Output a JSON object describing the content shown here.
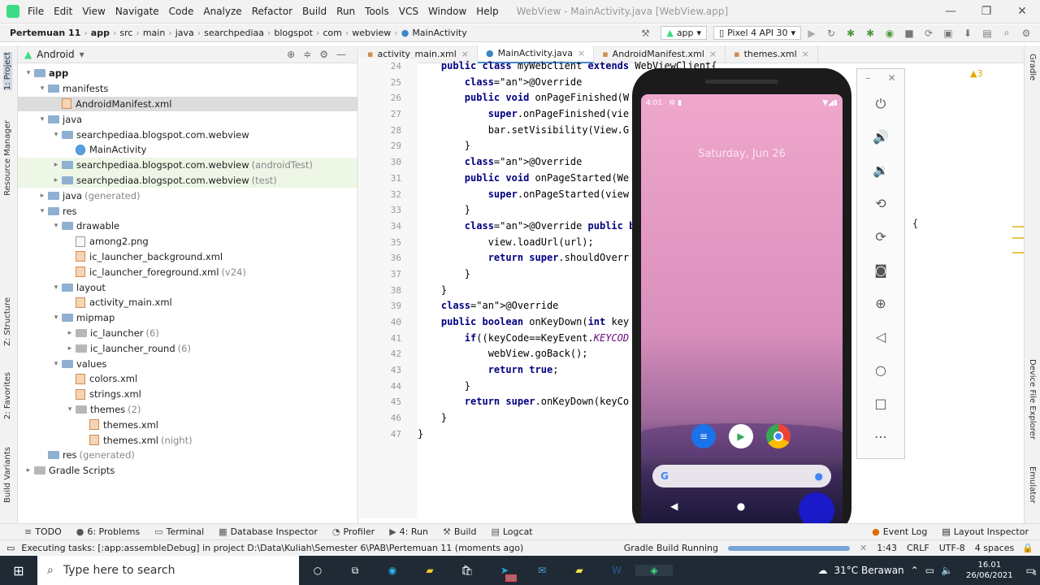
{
  "menu": {
    "items": [
      "File",
      "Edit",
      "View",
      "Navigate",
      "Code",
      "Analyze",
      "Refactor",
      "Build",
      "Run",
      "Tools",
      "VCS",
      "Window",
      "Help"
    ],
    "title": "WebView - MainActivity.java [WebView.app]"
  },
  "nav": {
    "breadcrumbs": [
      "Pertemuan 11",
      "app",
      "src",
      "main",
      "java",
      "searchpediaa",
      "blogspot",
      "com",
      "webview",
      "MainActivity"
    ],
    "run_config": "app",
    "device": "Pixel 4 API 30"
  },
  "project": {
    "view": "Android",
    "tree": [
      {
        "label": "app",
        "depth": 0,
        "arrow": "▾",
        "icon": "folder",
        "bold": true
      },
      {
        "label": "manifests",
        "depth": 1,
        "arrow": "▾",
        "icon": "folder"
      },
      {
        "label": "AndroidManifest.xml",
        "depth": 2,
        "arrow": "",
        "icon": "xml",
        "sel": true
      },
      {
        "label": "java",
        "depth": 1,
        "arrow": "▾",
        "icon": "folder"
      },
      {
        "label": "searchpediaa.blogspot.com.webview",
        "depth": 2,
        "arrow": "▾",
        "icon": "folder"
      },
      {
        "label": "MainActivity",
        "depth": 3,
        "arrow": "",
        "icon": "cls"
      },
      {
        "label": "searchpediaa.blogspot.com.webview",
        "extra": "(androidTest)",
        "depth": 2,
        "arrow": "▸",
        "icon": "folder",
        "hl": true
      },
      {
        "label": "searchpediaa.blogspot.com.webview",
        "extra": "(test)",
        "depth": 2,
        "arrow": "▸",
        "icon": "folder",
        "hl": true
      },
      {
        "label": "java",
        "extra": "(generated)",
        "depth": 1,
        "arrow": "▸",
        "icon": "folder"
      },
      {
        "label": "res",
        "depth": 1,
        "arrow": "▾",
        "icon": "folder"
      },
      {
        "label": "drawable",
        "depth": 2,
        "arrow": "▾",
        "icon": "folder"
      },
      {
        "label": "among2.png",
        "depth": 3,
        "arrow": "",
        "icon": "file"
      },
      {
        "label": "ic_launcher_background.xml",
        "depth": 3,
        "arrow": "",
        "icon": "xml"
      },
      {
        "label": "ic_launcher_foreground.xml",
        "extra": "(v24)",
        "depth": 3,
        "arrow": "",
        "icon": "xml"
      },
      {
        "label": "layout",
        "depth": 2,
        "arrow": "▾",
        "icon": "folder"
      },
      {
        "label": "activity_main.xml",
        "depth": 3,
        "arrow": "",
        "icon": "xml"
      },
      {
        "label": "mipmap",
        "depth": 2,
        "arrow": "▾",
        "icon": "folder"
      },
      {
        "label": "ic_launcher",
        "extra": "(6)",
        "depth": 3,
        "arrow": "▸",
        "icon": "gfolder"
      },
      {
        "label": "ic_launcher_round",
        "extra": "(6)",
        "depth": 3,
        "arrow": "▸",
        "icon": "gfolder"
      },
      {
        "label": "values",
        "depth": 2,
        "arrow": "▾",
        "icon": "folder"
      },
      {
        "label": "colors.xml",
        "depth": 3,
        "arrow": "",
        "icon": "xml"
      },
      {
        "label": "strings.xml",
        "depth": 3,
        "arrow": "",
        "icon": "xml"
      },
      {
        "label": "themes",
        "extra": "(2)",
        "depth": 3,
        "arrow": "▾",
        "icon": "gfolder"
      },
      {
        "label": "themes.xml",
        "depth": 4,
        "arrow": "",
        "icon": "xml"
      },
      {
        "label": "themes.xml",
        "extra": "(night)",
        "depth": 4,
        "arrow": "",
        "icon": "xml"
      },
      {
        "label": "res",
        "extra": "(generated)",
        "depth": 1,
        "arrow": "",
        "icon": "folder"
      },
      {
        "label": "Gradle Scripts",
        "depth": 0,
        "arrow": "▸",
        "icon": "gfolder"
      }
    ]
  },
  "editor": {
    "tabs": [
      "activity_main.xml",
      "MainActivity.java",
      "AndroidManifest.xml",
      "themes.xml"
    ],
    "active_tab": 1,
    "line_numbers": [
      "24",
      "25",
      "26",
      "27",
      "28",
      "29",
      "30",
      "31",
      "32",
      "33",
      "34",
      "35",
      "36",
      "37",
      "38",
      "39",
      "40",
      "41",
      "42",
      "43",
      "44",
      "45",
      "46",
      "47"
    ],
    "lines": [
      "    public class myWebclient extends WebViewClient{",
      "        @Override",
      "        public void onPageFinished(W",
      "            super.onPageFinished(vie",
      "            bar.setVisibility(View.G",
      "        }",
      "        @Override",
      "        public void onPageStarted(We",
      "            super.onPageStarted(view",
      "        }",
      "        @Override public boolean sho",
      "            view.loadUrl(url);",
      "            return super.shouldOverr",
      "        }",
      "    }",
      "    @Override",
      "    public boolean onKeyDown(int key",
      "        if((keyCode==KeyEvent.KEYCOD",
      "            webView.goBack();",
      "            return true;",
      "        }",
      "        return super.onKeyDown(keyCo",
      "    }",
      "}"
    ],
    "trailing_code": "rl) {",
    "warnings": "▲3"
  },
  "phone": {
    "time": "4:01",
    "date": "Saturday, Jun 26"
  },
  "bottom_tabs": [
    "TODO",
    "6: Problems",
    "Terminal",
    "Database Inspector",
    "Profiler",
    "4: Run",
    "Build",
    "Logcat"
  ],
  "bottom_right_tabs": [
    "Event Log",
    "Layout Inspector"
  ],
  "status": {
    "message": "Executing tasks: [:app:assembleDebug] in project D:\\Data\\Kuliah\\Semester 6\\PAB\\Pertemuan 11 (moments ago)",
    "gradle": "Gradle Build Running",
    "pos": "1:43",
    "eol": "CRLF",
    "enc": "UTF-8",
    "indent": "4 spaces"
  },
  "taskbar": {
    "search": "Type here to search",
    "weather": "31°C  Berawan",
    "time": "16.01",
    "date": "26/06/2021",
    "badge": "62",
    "notif": "4"
  },
  "left_tool_tabs": [
    "1: Project",
    "Resource Manager",
    "Z: Structure",
    "2: Favorites",
    "Build Variants"
  ],
  "right_tool_tabs": [
    "Gradle",
    "Device File Explorer",
    "Emulator"
  ],
  "colors": {
    "accent": "#4a88c7",
    "android": "#3ddc84"
  }
}
